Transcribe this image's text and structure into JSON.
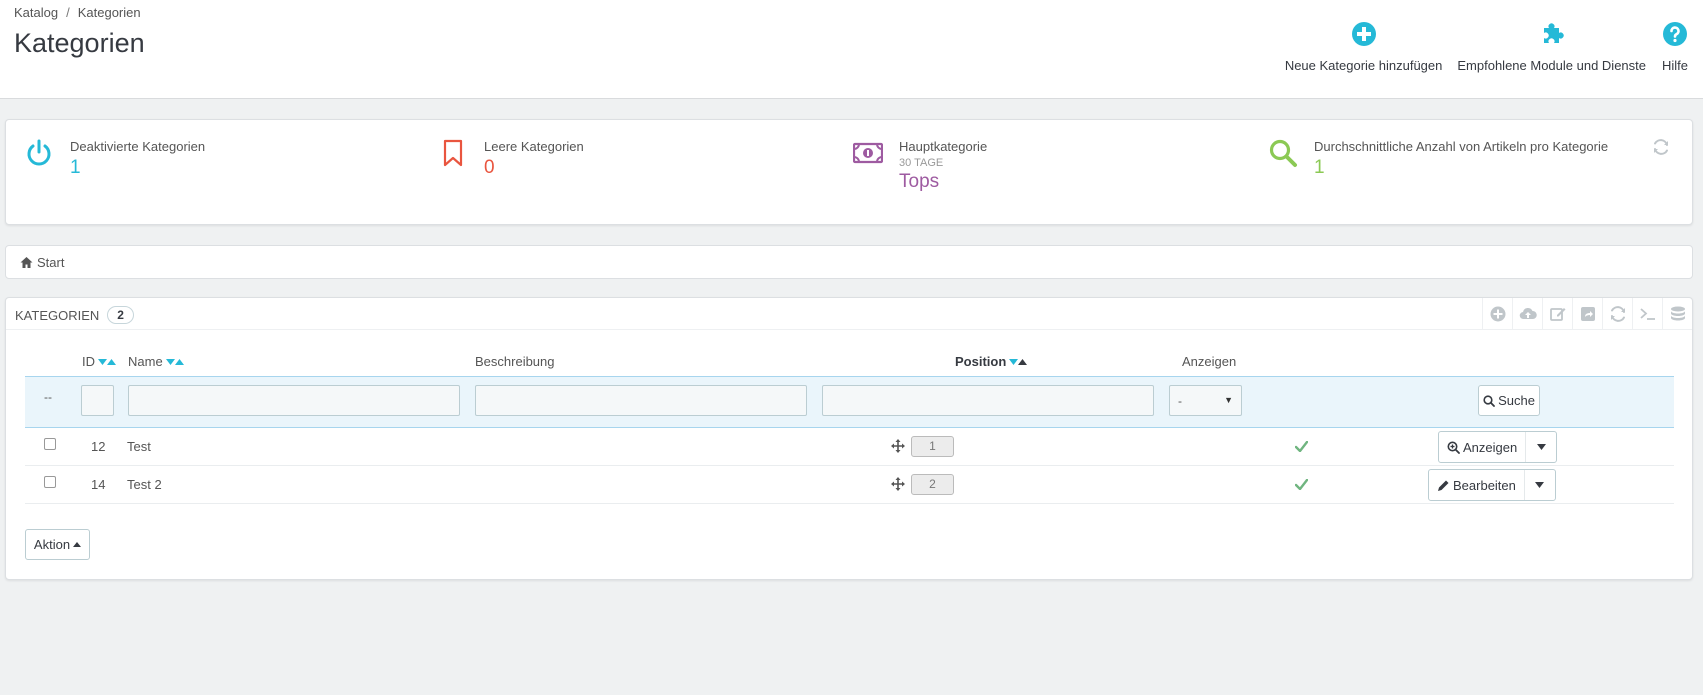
{
  "breadcrumb": {
    "parent": "Katalog",
    "separator": "/",
    "current": "Kategorien"
  },
  "page": {
    "title": "Kategorien"
  },
  "toolbar": {
    "add_label": "Neue Kategorie hinzufügen",
    "modules_label": "Empfohlene Module und Dienste",
    "help_label": "Hilfe",
    "accent": "#25b9d7"
  },
  "kpis": {
    "disabled": {
      "label": "Deaktivierte Kategorien",
      "value": "1",
      "color": "#25b9d7",
      "icon": "power-icon"
    },
    "empty": {
      "label": "Leere Kategorien",
      "value": "0",
      "color": "#e9553f",
      "icon": "bookmark-icon"
    },
    "top": {
      "label": "Hauptkategorie",
      "sub": "30 TAGE",
      "value": "Tops",
      "color": "#9e5ba1",
      "icon": "money-icon"
    },
    "avg": {
      "label": "Durchschnittliche Anzahl von Artikeln pro Kategorie",
      "value": "1",
      "color": "#8bc954",
      "icon": "search-icon"
    }
  },
  "nav": {
    "start_label": "Start"
  },
  "list": {
    "title": "Kategorien",
    "count": "2",
    "columns": {
      "id": "ID",
      "name": "Name",
      "description": "Beschreibung",
      "position": "Position",
      "display": "Anzeigen"
    },
    "filter": {
      "dash": "--",
      "display_selected": "-",
      "search_label": "Suche"
    },
    "rows": [
      {
        "id": "12",
        "name": "Test",
        "position": "1",
        "action": "Anzeigen"
      },
      {
        "id": "14",
        "name": "Test 2",
        "position": "2",
        "action": "Bearbeiten"
      }
    ],
    "bulk_label": "Aktion"
  }
}
